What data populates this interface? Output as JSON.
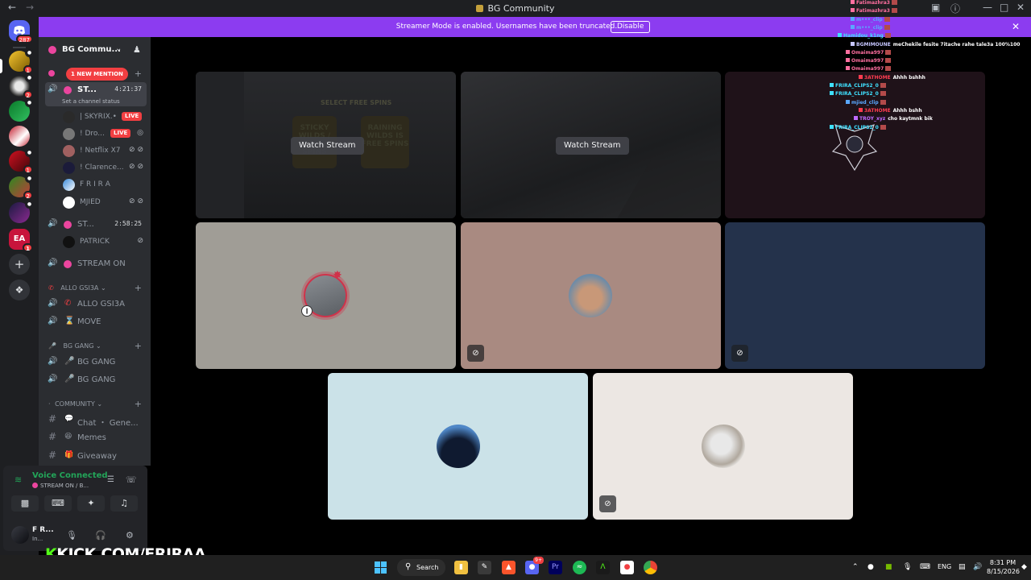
{
  "window": {
    "title": "BG Community"
  },
  "rail": {
    "home_badge": "287",
    "servers": [
      {
        "name": "server-1",
        "badge": "1"
      },
      {
        "name": "server-2",
        "badge": "2"
      },
      {
        "name": "server-3",
        "badge": ""
      },
      {
        "name": "server-4",
        "badge": ""
      },
      {
        "name": "server-5",
        "badge": "1"
      },
      {
        "name": "server-6",
        "badge": "2"
      },
      {
        "name": "server-7",
        "badge": ""
      },
      {
        "name": "server-ea",
        "label": "EA",
        "badge": "1"
      }
    ]
  },
  "banner": {
    "text": "Streamer Mode is enabled. Usernames have been truncated.",
    "disable_label": "Disable"
  },
  "guild": {
    "name": "BG Commu..."
  },
  "channels": {
    "new_mention": "1 NEW MENTION",
    "stage1": {
      "name": "ST...",
      "time": "4:21:37",
      "status": "Set a channel status"
    },
    "stage1_users": [
      {
        "name": "| SKYRIX.•",
        "live": "LIVE"
      },
      {
        "name": "! Dro...",
        "live": "LIVE"
      },
      {
        "name": "! Netflix X7",
        "live": ""
      },
      {
        "name": "! Clarence...",
        "live": ""
      },
      {
        "name": "F R I R A",
        "live": ""
      },
      {
        "name": "MJIED",
        "live": ""
      }
    ],
    "stage2": {
      "name": "ST...",
      "time": "2:58:25"
    },
    "stage2_users": [
      {
        "name": "PATRICK"
      }
    ],
    "stream_on": "STREAM ON",
    "cat_allo": "ALLO GSI3A",
    "allo_channel": "ALLO GSI3A",
    "move_channel": "MOVE",
    "cat_bg": "BG GANG",
    "bg_channel_1": "BG GANG",
    "bg_channel_2": "BG GANG",
    "cat_community": "COMMUNITY",
    "chat_general": "Chat ・ Gene...",
    "memes": "Memes",
    "giveaway": "Giveaway"
  },
  "voice": {
    "status": "Voice Connected",
    "channel": "STREAM ON / B..."
  },
  "user": {
    "name": "F R...",
    "status": "In..."
  },
  "stage": {
    "watch_label": "Watch Stream",
    "stream_1_title": "STICKY WILDS / FREE SPINS",
    "stream_1_ribbon": "SELECT FREE SPINS",
    "stream_1_right": "RAINING WILDS IS FREE SPINS"
  },
  "chat_overlay": [
    {
      "user": "Fatimazhra3",
      "msg": "",
      "color": "#ff6fa0"
    },
    {
      "user": "Fatimazhra3",
      "msg": "",
      "color": "#ff6fa0"
    },
    {
      "user": "m•••_clip",
      "msg": "",
      "color": "#5aa8ff"
    },
    {
      "user": "m•••_clip",
      "msg": "",
      "color": "#5aa8ff"
    },
    {
      "user": "Hamidou_k1ng",
      "msg": "",
      "color": "#3fe0ff"
    },
    {
      "user": "BGMIMOUNE",
      "msg": "meChekile fesite 7itache rahe tale3a 100%100",
      "color": "#c6c6ff"
    },
    {
      "user": "Omaima997",
      "msg": "",
      "color": "#ff6fa0"
    },
    {
      "user": "Omaima997",
      "msg": "",
      "color": "#ff6fa0"
    },
    {
      "user": "Omaima997",
      "msg": "",
      "color": "#ff6fa0"
    },
    {
      "user": "3ATHOME",
      "msg": "Ahhh bshhh",
      "color": "#ff3c50"
    },
    {
      "user": "FRIRA_CLIPS2_0",
      "msg": "",
      "color": "#3fe0ff"
    },
    {
      "user": "FRIRA_CLIPS2_0",
      "msg": "",
      "color": "#3fe0ff"
    },
    {
      "user": "mjied_clip",
      "msg": "",
      "color": "#5aa8ff"
    },
    {
      "user": "3ATHOME",
      "msg": "Ahhh bshh",
      "color": "#ff3c50"
    },
    {
      "user": "TROY_xyz",
      "msg": "cho kaytmnk bik",
      "color": "#c06bff"
    },
    {
      "user": "FRIRA_CLIPS2_0",
      "msg": "",
      "color": "#3fe0ff"
    }
  ],
  "watermark": {
    "k": "K",
    "rest": "KICK.COM/FRIRAA"
  },
  "taskbar": {
    "search_label": "Search",
    "discord_badge": "9+",
    "lang": "ENG",
    "time": "8:31 PM",
    "date": "8/15/2026"
  },
  "colors": {
    "accent_purple": "#8c3cf0",
    "voice_green": "#23a559",
    "live_red": "#f23f42",
    "kick_green": "#53fc18"
  }
}
